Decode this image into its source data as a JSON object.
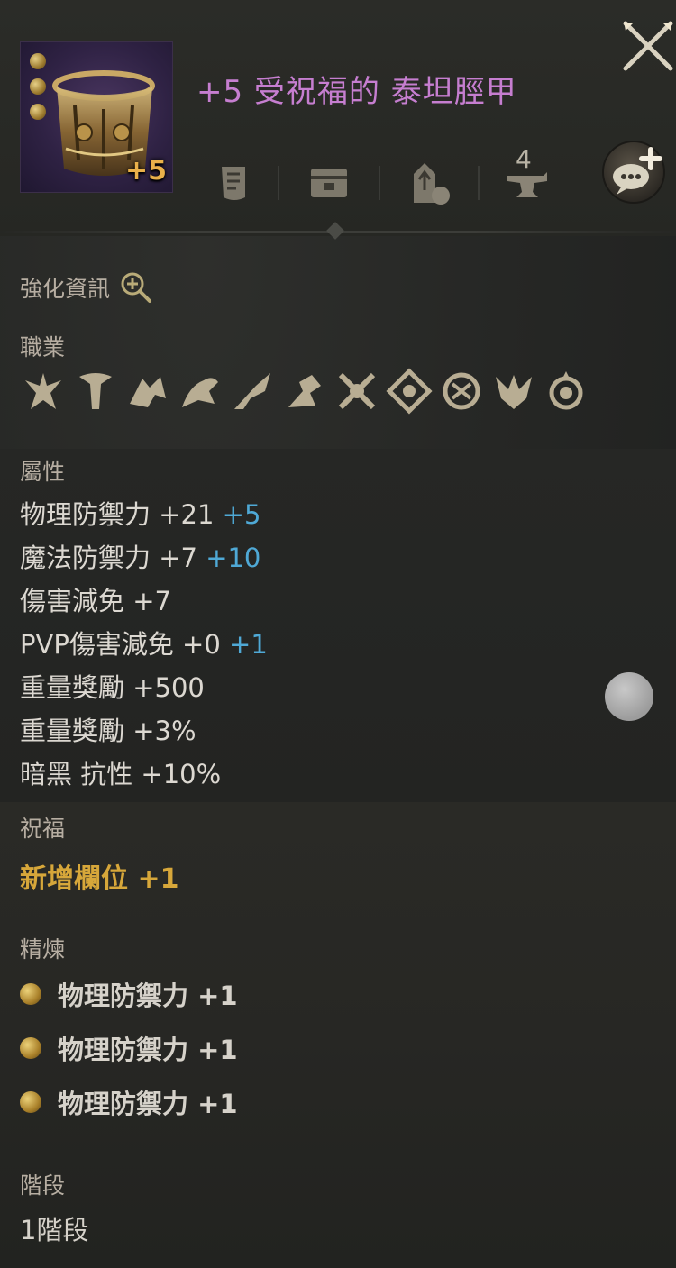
{
  "item": {
    "enhance_badge": "+5",
    "title": "+5 受祝福的 泰坦脛甲"
  },
  "toolbar": {
    "tools": [
      {
        "name": "scroll-icon"
      },
      {
        "name": "chest-icon"
      },
      {
        "name": "upgrade-pot-icon"
      },
      {
        "name": "anvil-icon"
      }
    ],
    "anvil_count": "4"
  },
  "enhance_info": {
    "label": "強化資訊"
  },
  "classes": {
    "label": "職業",
    "icons": [
      "class-1-icon",
      "class-2-icon",
      "class-3-icon",
      "class-4-icon",
      "class-5-icon",
      "class-6-icon",
      "class-7-icon",
      "class-8-icon",
      "class-9-icon",
      "class-10-icon",
      "class-11-icon"
    ]
  },
  "attributes": {
    "label": "屬性",
    "lines": [
      {
        "text": "物理防禦力 +21",
        "bonus": "+5"
      },
      {
        "text": "魔法防禦力 +7",
        "bonus": "+10"
      },
      {
        "text": "傷害減免 +7",
        "bonus": ""
      },
      {
        "text": "PVP傷害減免 +0",
        "bonus": "+1"
      },
      {
        "text": "重量獎勵 +500",
        "bonus": ""
      },
      {
        "text": "重量獎勵 +3%",
        "bonus": ""
      },
      {
        "text": "暗黑 抗性 +10%",
        "bonus": ""
      }
    ]
  },
  "blessing": {
    "label": "祝福",
    "line": "新增欄位 +1"
  },
  "refine": {
    "label": "精煉",
    "items": [
      "物理防禦力 +1",
      "物理防禦力 +1",
      "物理防禦力 +1"
    ]
  },
  "stage": {
    "label": "階段",
    "value": "1階段"
  },
  "colors": {
    "title": "#c67ed0",
    "bonus": "#4fa9d6",
    "blessing": "#d7a73a",
    "badge": "#e9b04a"
  }
}
